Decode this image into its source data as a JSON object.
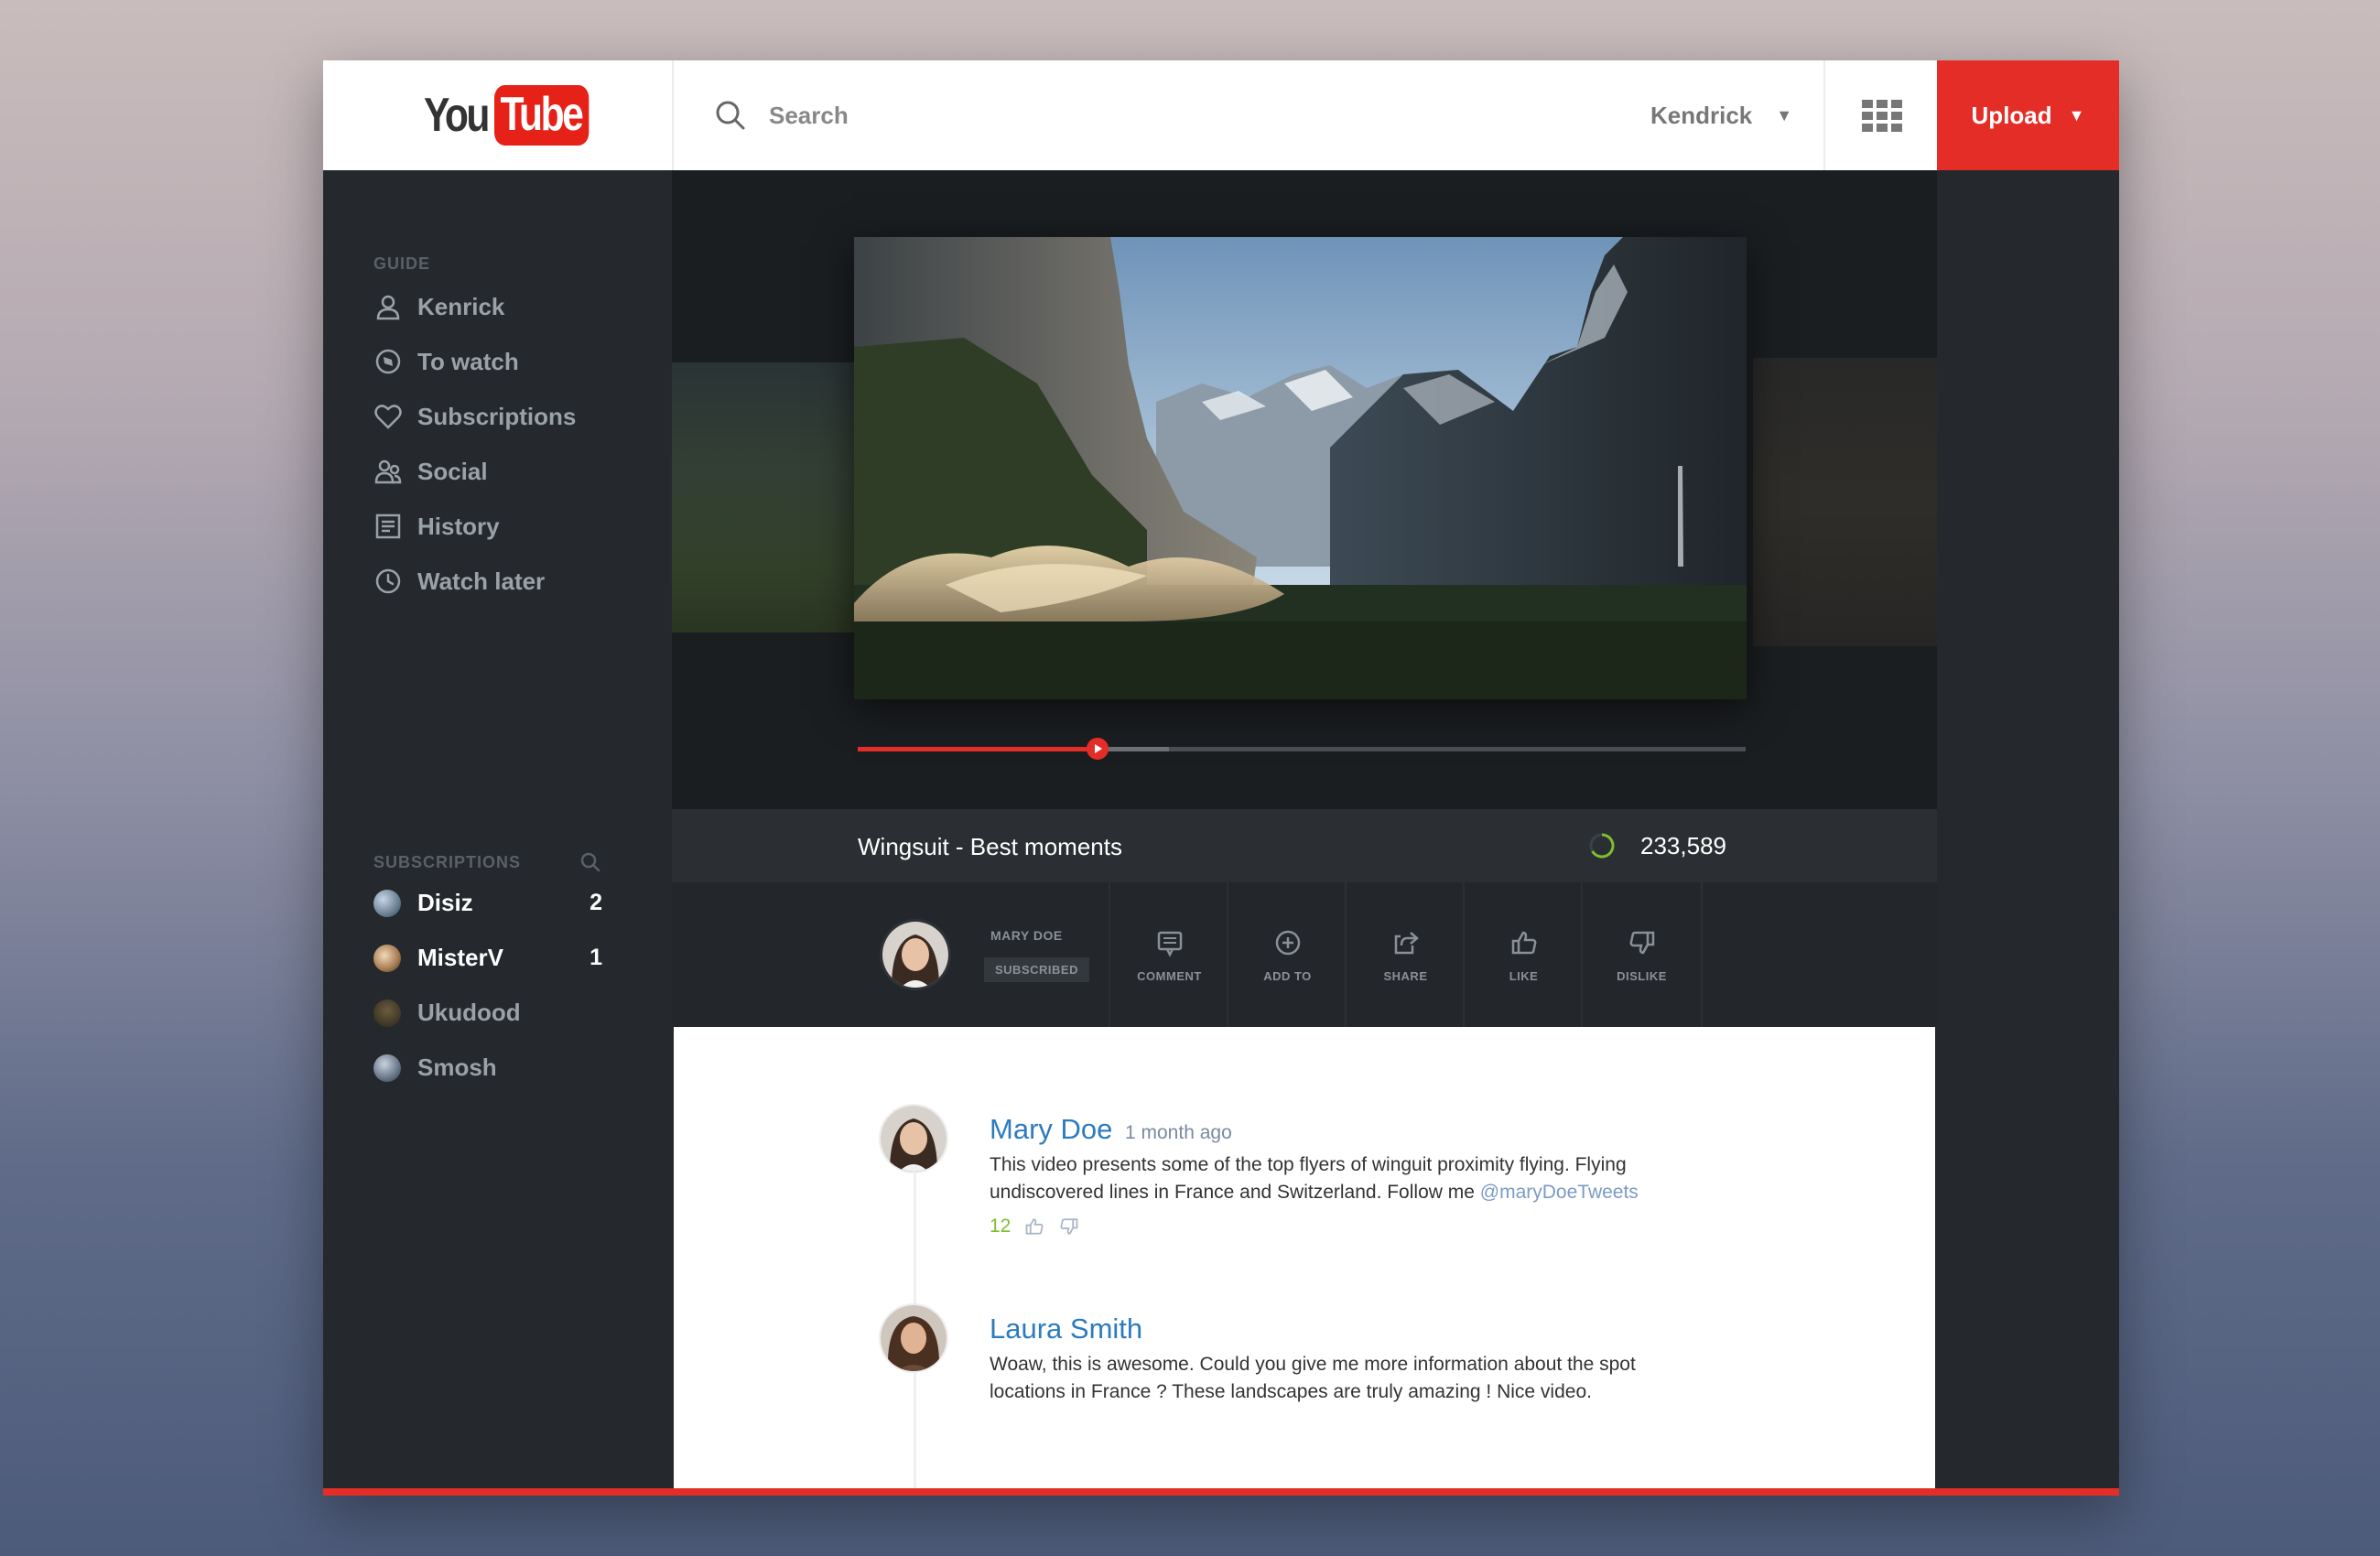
{
  "header": {
    "logo_you": "You",
    "logo_tube": "Tube",
    "search_placeholder": "Search",
    "user_name": "Kendrick",
    "upload_label": "Upload"
  },
  "sidebar": {
    "guide_title": "GUIDE",
    "guide_items": [
      {
        "label": "Kenrick",
        "icon": "user-icon"
      },
      {
        "label": "To watch",
        "icon": "compass-icon"
      },
      {
        "label": "Subscriptions",
        "icon": "heart-icon"
      },
      {
        "label": "Social",
        "icon": "social-icon"
      },
      {
        "label": "History",
        "icon": "history-icon"
      },
      {
        "label": "Watch later",
        "icon": "clock-icon"
      }
    ],
    "subscriptions_title": "SUBSCRIPTIONS",
    "subscriptions": [
      {
        "label": "Disiz",
        "count": "2"
      },
      {
        "label": "MisterV",
        "count": "1"
      },
      {
        "label": "Ukudood",
        "count": ""
      },
      {
        "label": "Smosh",
        "count": ""
      }
    ]
  },
  "player": {
    "progress": 0.27,
    "buffered": 0.35
  },
  "video": {
    "title": "Wingsuit - Best moments",
    "views": "233,589"
  },
  "channel": {
    "name": "MARY DOE",
    "subscribed_label": "SUBSCRIBED"
  },
  "actions": {
    "comment": "COMMENT",
    "add_to": "ADD TO",
    "share": "SHARE",
    "like": "LIKE",
    "dislike": "DISLIKE"
  },
  "comments": [
    {
      "author": "Mary Doe",
      "time": "1 month ago",
      "text": "This video presents some of the top flyers of winguit proximity flying. Flying undiscovered lines in France and Switzerland. Follow me ",
      "mention": "@maryDoeTweets",
      "likes": "12"
    },
    {
      "author": "Laura Smith",
      "text": "Woaw, this is awesome. Could you give me more information about the spot locations in France ? These landscapes are truly amazing ! Nice video."
    }
  ],
  "colors": {
    "brand_red": "#e52d27",
    "sidebar_bg": "#25292d",
    "link_blue": "#2c7bbf",
    "like_green": "#7dbf2f"
  }
}
